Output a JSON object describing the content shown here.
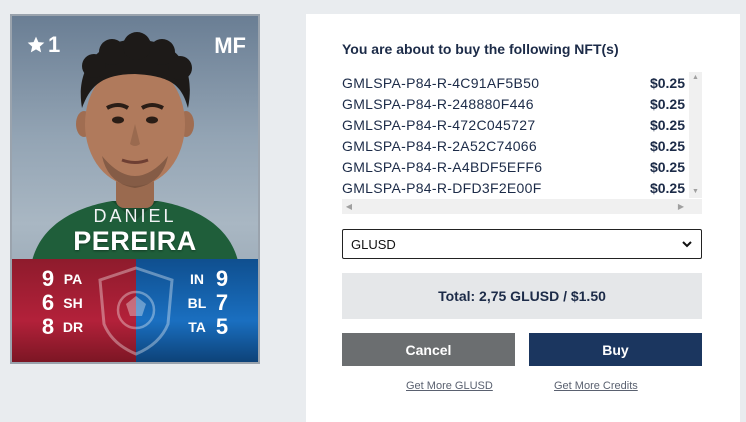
{
  "card": {
    "rank": "1",
    "position": "MF",
    "first_name": "DANIEL",
    "last_name": "PEREIRA",
    "stats_left": [
      {
        "value": "9",
        "label": "PA"
      },
      {
        "value": "6",
        "label": "SH"
      },
      {
        "value": "8",
        "label": "DR"
      }
    ],
    "stats_right": [
      {
        "value": "9",
        "label": "IN"
      },
      {
        "value": "7",
        "label": "BL"
      },
      {
        "value": "5",
        "label": "TA"
      }
    ],
    "colors": {
      "attack": "#b3213a",
      "defense": "#1a6fc0"
    }
  },
  "purchase": {
    "title": "You are about to buy the following NFT(s)",
    "items": [
      {
        "id": "GMLSPA-P84-R-4C91AF5B50",
        "price": "$0.25"
      },
      {
        "id": "GMLSPA-P84-R-248880F446",
        "price": "$0.25"
      },
      {
        "id": "GMLSPA-P84-R-472C045727",
        "price": "$0.25"
      },
      {
        "id": "GMLSPA-P84-R-2A52C74066",
        "price": "$0.25"
      },
      {
        "id": "GMLSPA-P84-R-A4BDF5EFF6",
        "price": "$0.25"
      },
      {
        "id": "GMLSPA-P84-R-DFD3F2E00F",
        "price": "$0.25"
      }
    ],
    "currency_selected": "GLUSD",
    "total": "Total: 2,75 GLUSD / $1.50",
    "cancel_label": "Cancel",
    "buy_label": "Buy",
    "link_glusd": "Get More GLUSD",
    "link_credits": "Get More Credits",
    "colors": {
      "primary": "#1b365f",
      "secondary": "#6b6e70"
    }
  }
}
